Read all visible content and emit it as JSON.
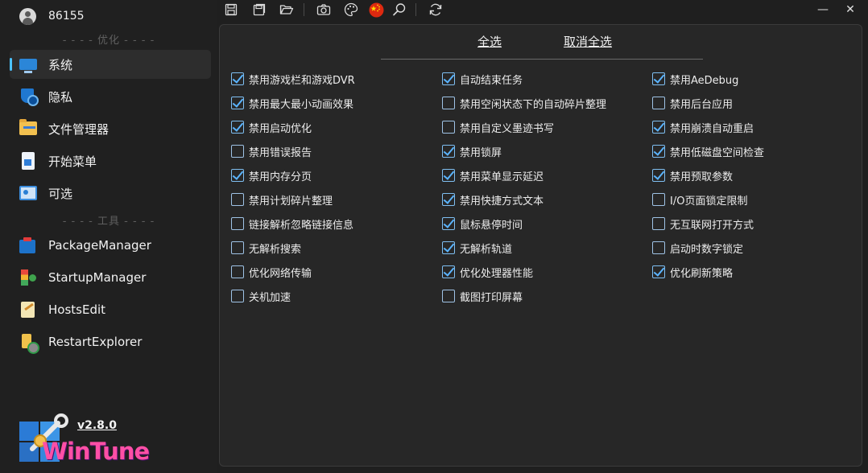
{
  "user": {
    "name": "86155"
  },
  "sidebar": {
    "divider_optimize": "- - - - 优化 - - - -",
    "divider_tools": "- - - - 工具 - - - -",
    "items": [
      {
        "label": "系统",
        "icon": "monitor-icon",
        "active": true
      },
      {
        "label": "隐私",
        "icon": "shield-icon"
      },
      {
        "label": "文件管理器",
        "icon": "folder-icon"
      },
      {
        "label": "开始菜单",
        "icon": "start-menu-icon"
      },
      {
        "label": "可选",
        "icon": "optional-panel-icon"
      }
    ],
    "tools": [
      {
        "label": "PackageManager",
        "icon": "package-icon"
      },
      {
        "label": "StartupManager",
        "icon": "startup-icon"
      },
      {
        "label": "HostsEdit",
        "icon": "hosts-edit-icon"
      },
      {
        "label": "RestartExplorer",
        "icon": "restart-explorer-icon"
      }
    ]
  },
  "branding": {
    "version": "v2.8.0",
    "logo_text": "WinTune"
  },
  "toolbar": {
    "icons": [
      "save-icon",
      "save-as-icon",
      "open-folder-icon",
      "camera-icon",
      "palette-icon",
      "china-flag-icon",
      "search-icon",
      "refresh-icon"
    ]
  },
  "window": {
    "minimize": "—",
    "close": "✕"
  },
  "panel": {
    "select_all": "全选",
    "deselect_all": "取消全选",
    "columns": [
      [
        {
          "label": "禁用游戏栏和游戏DVR",
          "checked": true
        },
        {
          "label": "禁用最大最小动画效果",
          "checked": true
        },
        {
          "label": "禁用启动优化",
          "checked": true
        },
        {
          "label": "禁用错误报告",
          "checked": false
        },
        {
          "label": "禁用内存分页",
          "checked": true
        },
        {
          "label": "禁用计划碎片整理",
          "checked": false
        },
        {
          "label": "链接解析忽略链接信息",
          "checked": false
        },
        {
          "label": "无解析搜索",
          "checked": false
        },
        {
          "label": "优化网络传输",
          "checked": false
        },
        {
          "label": "关机加速",
          "checked": false
        }
      ],
      [
        {
          "label": "自动结束任务",
          "checked": true
        },
        {
          "label": "禁用空闲状态下的自动碎片整理",
          "checked": false
        },
        {
          "label": "禁用自定义墨迹书写",
          "checked": false
        },
        {
          "label": "禁用锁屏",
          "checked": true
        },
        {
          "label": "禁用菜单显示延迟",
          "checked": true
        },
        {
          "label": "禁用快捷方式文本",
          "checked": true
        },
        {
          "label": "鼠标悬停时间",
          "checked": true
        },
        {
          "label": "无解析轨道",
          "checked": true
        },
        {
          "label": "优化处理器性能",
          "checked": true
        },
        {
          "label": "截图打印屏幕",
          "checked": false
        }
      ],
      [
        {
          "label": "禁用AeDebug",
          "checked": true
        },
        {
          "label": "禁用后台应用",
          "checked": false
        },
        {
          "label": "禁用崩溃自动重启",
          "checked": true
        },
        {
          "label": "禁用低磁盘空间检查",
          "checked": true
        },
        {
          "label": "禁用预取参数",
          "checked": true
        },
        {
          "label": "I/O页面锁定限制",
          "checked": false
        },
        {
          "label": "无互联网打开方式",
          "checked": false
        },
        {
          "label": "启动时数字锁定",
          "checked": false
        },
        {
          "label": "优化刷新策略",
          "checked": true
        }
      ]
    ]
  }
}
